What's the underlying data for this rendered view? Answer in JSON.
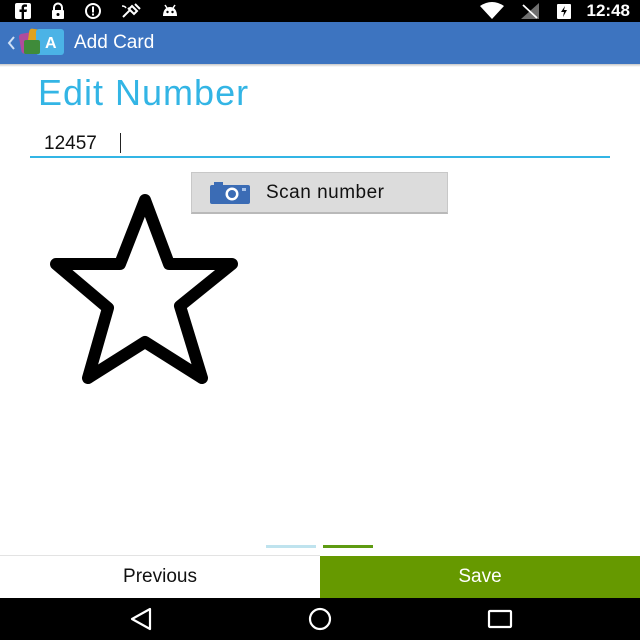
{
  "status_bar": {
    "time": "12:48",
    "icons": [
      "facebook-icon",
      "lock-icon",
      "info-icon",
      "satellite-icon",
      "android-icon",
      "wifi-icon",
      "signal-off-icon",
      "battery-charging-icon"
    ]
  },
  "action_bar": {
    "title": "Add Card",
    "icon": "app-icon"
  },
  "main": {
    "title": "Edit Number",
    "number_input": {
      "value": "12457",
      "placeholder": ""
    },
    "scan_button": {
      "label": "Scan number",
      "icon": "camera-icon"
    },
    "star_icon": "star-icon"
  },
  "pager": {
    "pages": 2,
    "current": 2
  },
  "footer": {
    "previous_label": "Previous",
    "save_label": "Save"
  },
  "nav_bar": {
    "icons": [
      "back-icon",
      "home-icon",
      "recents-icon"
    ]
  },
  "colors": {
    "action_bar": "#3d74c0",
    "title_accent": "#33b5e5",
    "save_green": "#669900",
    "scan_button_bg": "#dcdcdc"
  }
}
